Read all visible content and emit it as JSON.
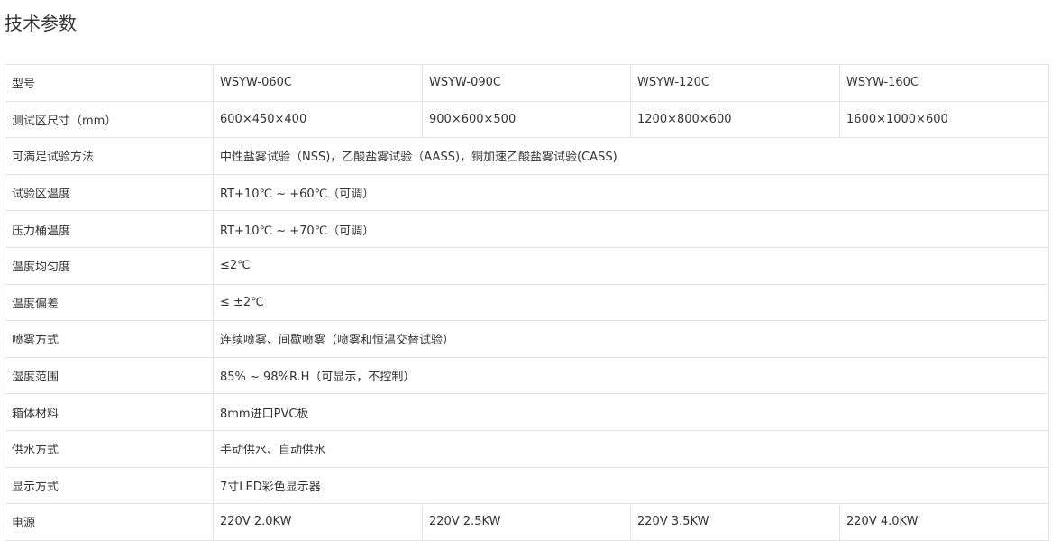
{
  "page": {
    "title": "技术参数"
  },
  "models": [
    "WSYW-060C",
    "WSYW-090C",
    "WSYW-120C",
    "WSYW-160C"
  ],
  "rows": {
    "model": {
      "label": "型号"
    },
    "test_size": {
      "label": "测试区尺寸（mm）",
      "values": [
        "600×450×400",
        "900×600×500",
        "1200×800×600",
        "1600×1000×600"
      ]
    },
    "test_methods": {
      "label": "可满足试验方法",
      "value": "中性盐雾试验（NSS)，乙酸盐雾试验（AASS)，铜加速乙酸盐雾试验(CASS)"
    },
    "test_temp": {
      "label": "试验区温度",
      "value": "RT+10℃ ~ +60℃（可调）"
    },
    "tank_temp": {
      "label": "压力桶温度",
      "value": "RT+10℃ ~ +70℃（可调）"
    },
    "temp_uniformity": {
      "label": "温度均匀度",
      "value": "≤2℃"
    },
    "temp_deviation": {
      "label": "温度偏差",
      "value": "≤ ±2℃"
    },
    "spray_mode": {
      "label": "喷雾方式",
      "value": "连续喷雾、间歇喷雾（喷雾和恒温交替试验）"
    },
    "humidity_range": {
      "label": "湿度范围",
      "value": "85% ~ 98%R.H（可显示，不控制）"
    },
    "cabinet_material": {
      "label": "箱体材料",
      "value": "8mm进口PVC板"
    },
    "water_supply": {
      "label": "供水方式",
      "value": "手动供水、自动供水"
    },
    "display": {
      "label": "显示方式",
      "value": "7寸LED彩色显示器"
    },
    "power": {
      "label": "电源",
      "values": [
        "220V 2.0KW",
        "220V 2.5KW",
        "220V 3.5KW",
        "220V 4.0KW"
      ]
    }
  },
  "colors": {
    "border": "#e3e3e3",
    "text": "#333333",
    "background": "#ffffff"
  }
}
